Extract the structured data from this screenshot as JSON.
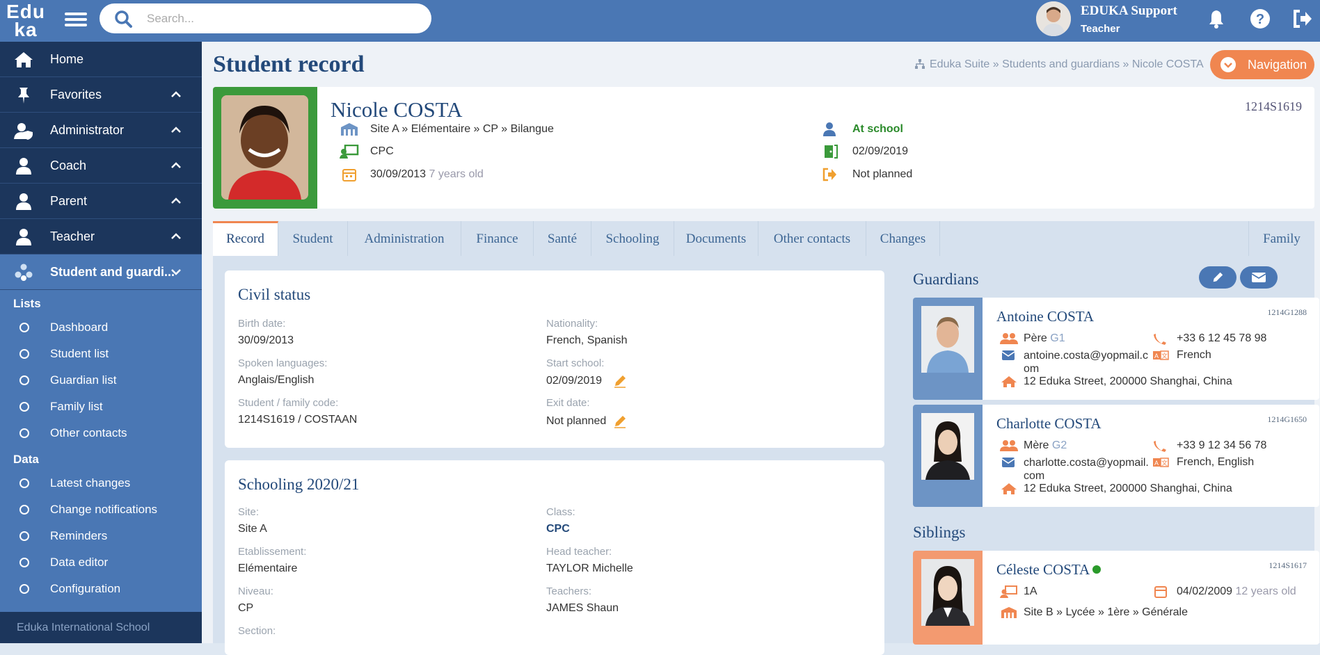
{
  "app": {
    "logo": "Edu ka",
    "search_placeholder": "Search...",
    "user_name": "EDUKA Support",
    "user_role": "Teacher"
  },
  "sidebar": {
    "items": [
      {
        "label": "Home",
        "icon": "home-icon"
      },
      {
        "label": "Favorites",
        "icon": "pin-icon"
      },
      {
        "label": "Administrator",
        "icon": "user-shield-icon"
      },
      {
        "label": "Coach",
        "icon": "user-icon"
      },
      {
        "label": "Parent",
        "icon": "user-icon"
      },
      {
        "label": "Teacher",
        "icon": "user-icon"
      },
      {
        "label": "Student and guardi...",
        "icon": "users-icon"
      }
    ],
    "groups": [
      {
        "title": "Lists",
        "items": [
          "Dashboard",
          "Student list",
          "Guardian list",
          "Family list",
          "Other contacts"
        ]
      },
      {
        "title": "Data",
        "items": [
          "Latest changes",
          "Change notifications",
          "Reminders",
          "Data editor",
          "Configuration"
        ]
      }
    ],
    "footer": "Eduka International School"
  },
  "page": {
    "title": "Student record",
    "breadcrumb": "Eduka Suite » Students and guardians » Nicole COSTA",
    "nav_button": "Navigation"
  },
  "student": {
    "name": "Nicole COSTA",
    "id": "1214S1619",
    "path": "Site A » Elémentaire » CP » Bilangue",
    "class": "CPC",
    "birth": "30/09/2013",
    "age": "7 years old",
    "status": "At school",
    "start": "02/09/2019",
    "exit": "Not planned"
  },
  "tabs": [
    "Record",
    "Student",
    "Administration",
    "Finance",
    "Santé",
    "Schooling",
    "Documents",
    "Other contacts",
    "Changes",
    "Family"
  ],
  "civil": {
    "title": "Civil status",
    "birth_label": "Birth date:",
    "birth": "30/09/2013",
    "lang_label": "Spoken languages:",
    "lang": "Anglais/English",
    "code_label": "Student / family code:",
    "code": "1214S1619 / COSTAAN",
    "nat_label": "Nationality:",
    "nat": "French, Spanish",
    "start_label": "Start school:",
    "start": "02/09/2019",
    "exit_label": "Exit date:",
    "exit": "Not planned"
  },
  "schooling": {
    "title": "Schooling 2020/21",
    "site_label": "Site:",
    "site": "Site A",
    "etab_label": "Etablissement:",
    "etab": "Elémentaire",
    "niv_label": "Niveau:",
    "niv": "CP",
    "sec_label": "Section:",
    "class_label": "Class:",
    "class": "CPC",
    "head_label": "Head teacher:",
    "head": "TAYLOR Michelle",
    "teachers_label": "Teachers:",
    "teachers": "JAMES Shaun"
  },
  "guardians": {
    "title": "Guardians",
    "list": [
      {
        "name": "Antoine COSTA",
        "id": "1214G1288",
        "role": "Père",
        "g": "G1",
        "phone": "+33 6 12 45 78 98",
        "email1": "antoine.costa@yopmail.c",
        "email2": "om",
        "lang": "French",
        "address": "12 Eduka Street, 200000 Shanghai, China"
      },
      {
        "name": "Charlotte COSTA",
        "id": "1214G1650",
        "role": "Mère",
        "g": "G2",
        "phone": "+33 9 12 34 56 78",
        "email1": "charlotte.costa@yopmail.",
        "email2": "com",
        "lang": "French, English",
        "address": "12 Eduka Street, 200000 Shanghai, China"
      }
    ]
  },
  "siblings": {
    "title": "Siblings",
    "list": [
      {
        "name": "Céleste COSTA",
        "id": "1214S1617",
        "class": "1A",
        "birth": "04/02/2009",
        "age": "12 years old",
        "path": "Site B » Lycée » 1ère » Générale"
      }
    ]
  }
}
